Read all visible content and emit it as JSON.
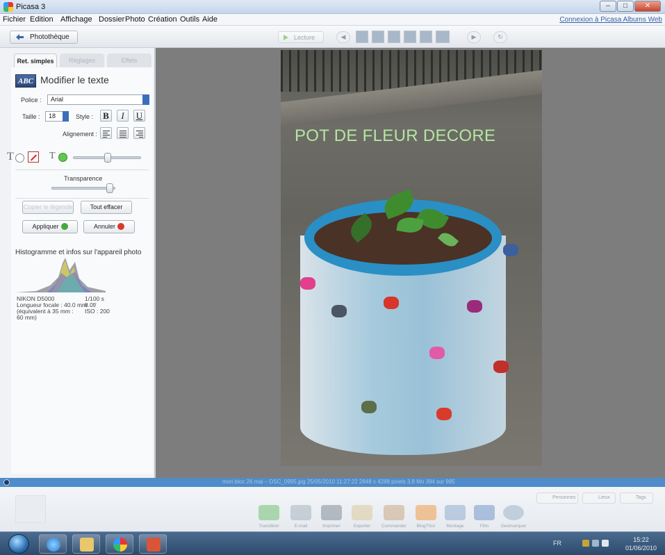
{
  "window": {
    "title": "Picasa 3",
    "minimize": "–",
    "maximize": "□",
    "close": "✕"
  },
  "menu": {
    "items": [
      "Fichier",
      "Edition",
      "Affichage",
      "Dossier",
      "Photo",
      "Création",
      "Outils",
      "Aide"
    ],
    "web_link": "Connexion à Picasa Albums Web"
  },
  "toolbar": {
    "library_button": "Photothèque",
    "play_label": "Lecture"
  },
  "tabs": [
    "Ret. simples",
    "Réglages",
    "Effets"
  ],
  "text_tool": {
    "icon_label": "ABC",
    "title": "Modifier le texte",
    "font_label": "Police :",
    "font_value": "Arial",
    "size_label": "Taille :",
    "size_value": "18",
    "style_label": "Style :",
    "bold": "B",
    "italic": "I",
    "underline": "U",
    "align_label": "Alignement :",
    "transparency_label": "Transparence",
    "copy_button": "Copier le légende",
    "clear_button": "Tout effacer",
    "apply_button": "Appliquer",
    "cancel_button": "Annuler",
    "text_color_letter": "T",
    "outline_color_letter": "T"
  },
  "histogram": {
    "title": "Histogramme et infos sur l'appareil photo",
    "camera": "NIKON D5000",
    "focal": "Longueur focale : 40.0 mm",
    "equiv": "(équivalent à 35 mm :",
    "equiv2": "60 mm)",
    "shutter": "1/100 s",
    "aperture": "8.0f/",
    "iso": "ISO : 200"
  },
  "photo": {
    "caption": "POT DE FLEUR DECORE"
  },
  "statusbar": {
    "text": "mon bloc 26 mai – DSC_0995.jpg   25/05/2010 11:27:22   2848 x 4288 pixels   3,8 Mo   394 sur 985"
  },
  "tray": {
    "people_button": "Personnes",
    "places_button": "Lieux",
    "tags_button": "Tags",
    "actions": [
      "Transférer",
      "E-mail",
      "Imprimer",
      "Exporter",
      "Commander",
      "BlogThis!",
      "Montage",
      "Film",
      "Geomarquer"
    ]
  },
  "taskbar": {
    "lang": "FR",
    "time": "15:22",
    "date": "01/06/2010"
  },
  "colors": {
    "accent_blue": "#3c6fbb",
    "caption_green": "#b4e6a2",
    "status_blue": "#4f8cc9"
  }
}
